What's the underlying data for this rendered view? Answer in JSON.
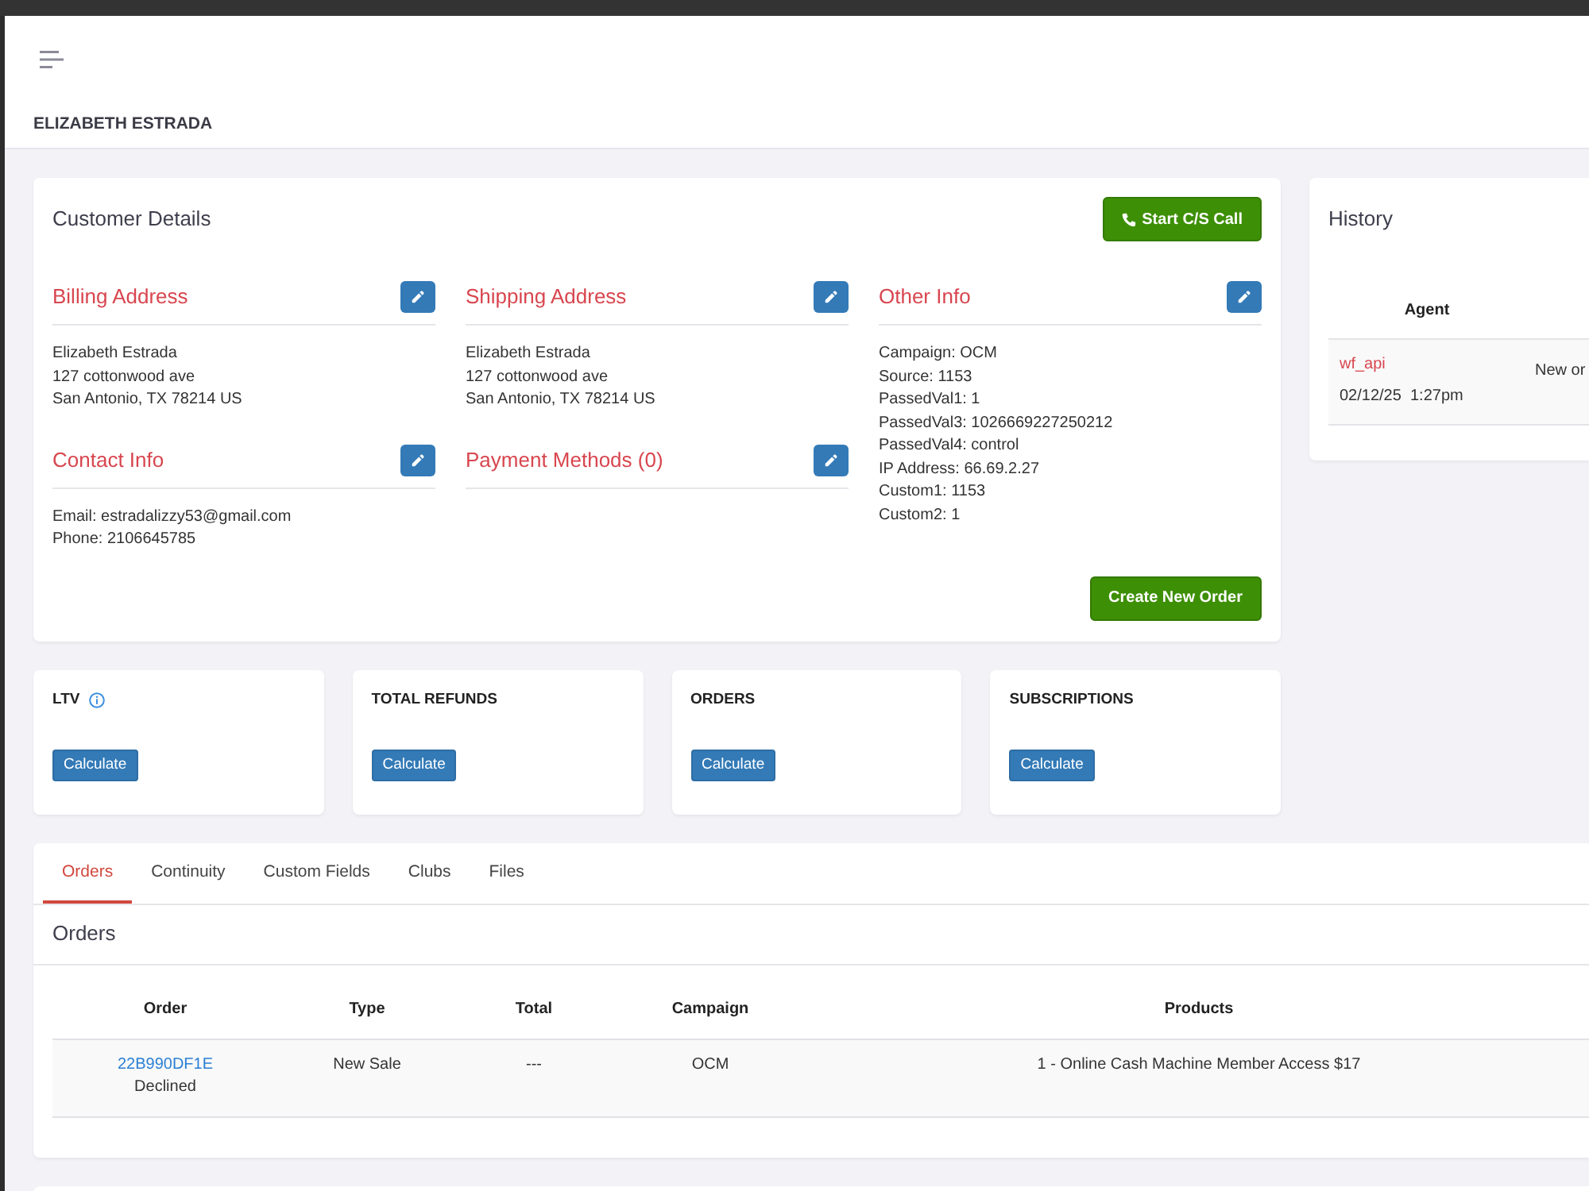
{
  "header": {
    "title": "ELIZABETH ESTRADA"
  },
  "customer_details": {
    "title": "Customer Details",
    "call_button": "Start C/S Call",
    "columns": [
      {
        "sections": [
          {
            "title": "Billing Address",
            "lines": [
              "Elizabeth Estrada",
              "127 cottonwood ave",
              "San Antonio, TX 78214 US"
            ]
          },
          {
            "title": "Contact Info",
            "lines": [
              "Email: estradalizzy53@gmail.com",
              "Phone: 2106645785"
            ]
          }
        ]
      },
      {
        "sections": [
          {
            "title": "Shipping Address",
            "lines": [
              "Elizabeth Estrada",
              "127 cottonwood ave",
              "San Antonio, TX 78214 US"
            ]
          },
          {
            "title": "Payment Methods (0)"
          }
        ]
      },
      {
        "sections": [
          {
            "title": "Other Info",
            "lines": [
              "Campaign: OCM",
              "Source: 1153",
              "PassedVal1: 1",
              "PassedVal3: 1026669227250212",
              "PassedVal4: control",
              "IP Address: 66.69.2.27",
              "Custom1: 1153",
              "Custom2: 1"
            ]
          }
        ]
      }
    ],
    "create_button": "Create New Order"
  },
  "history": {
    "title": "History",
    "columns": [
      "Agent"
    ],
    "rows": [
      {
        "agent": "wf_api",
        "time": "02/12/25  1:27pm",
        "column_2": "New or"
      }
    ]
  },
  "stats": [
    {
      "title": "LTV",
      "info": true,
      "button": "Calculate"
    },
    {
      "title": "TOTAL REFUNDS",
      "info": false,
      "button": "Calculate"
    },
    {
      "title": "ORDERS",
      "info": false,
      "button": "Calculate"
    },
    {
      "title": "SUBSCRIPTIONS",
      "info": false,
      "button": "Calculate"
    }
  ],
  "tabs": [
    {
      "label": "Orders",
      "selected": true
    },
    {
      "label": "Continuity",
      "selected": false
    },
    {
      "label": "Custom Fields",
      "selected": false
    },
    {
      "label": "Clubs",
      "selected": false
    },
    {
      "label": "Files",
      "selected": false
    }
  ],
  "orders": {
    "title": "Orders",
    "columns": [
      "Order",
      "Type",
      "Total",
      "Campaign",
      "Products"
    ],
    "rows": [
      {
        "order": "22B990DF1E",
        "status": "Declined",
        "type": "New Sale",
        "total": "---",
        "campaign": "OCM",
        "products": "1 - Online Cash Machine Member Access $17"
      }
    ]
  }
}
